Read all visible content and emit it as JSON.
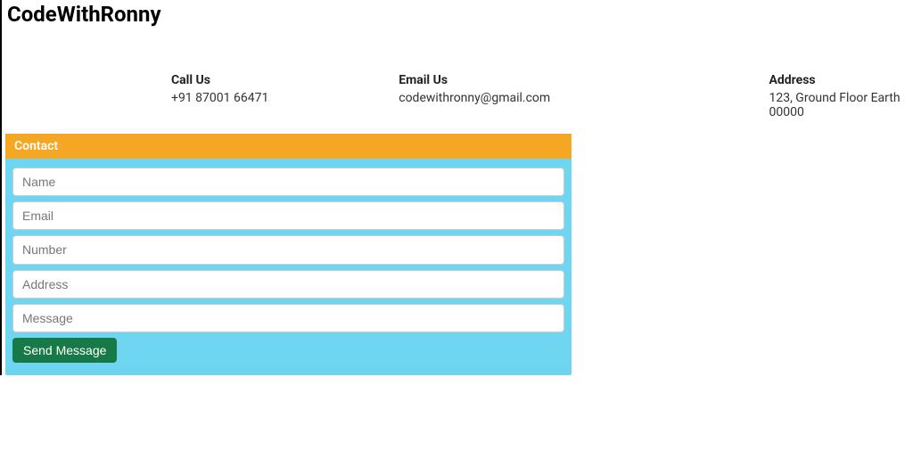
{
  "brand": "CodeWithRonny",
  "info": {
    "call": {
      "title": "Call Us",
      "value": "+91 87001 66471"
    },
    "email": {
      "title": "Email Us",
      "value": "codewithronny@gmail.com"
    },
    "address": {
      "title": "Address",
      "value": "123, Ground Floor Earth 00000"
    }
  },
  "card": {
    "header": "Contact",
    "fields": {
      "name": {
        "placeholder": "Name"
      },
      "email": {
        "placeholder": "Email"
      },
      "number": {
        "placeholder": "Number"
      },
      "address": {
        "placeholder": "Address"
      },
      "message": {
        "placeholder": "Message"
      }
    },
    "submit_label": "Send Message"
  }
}
